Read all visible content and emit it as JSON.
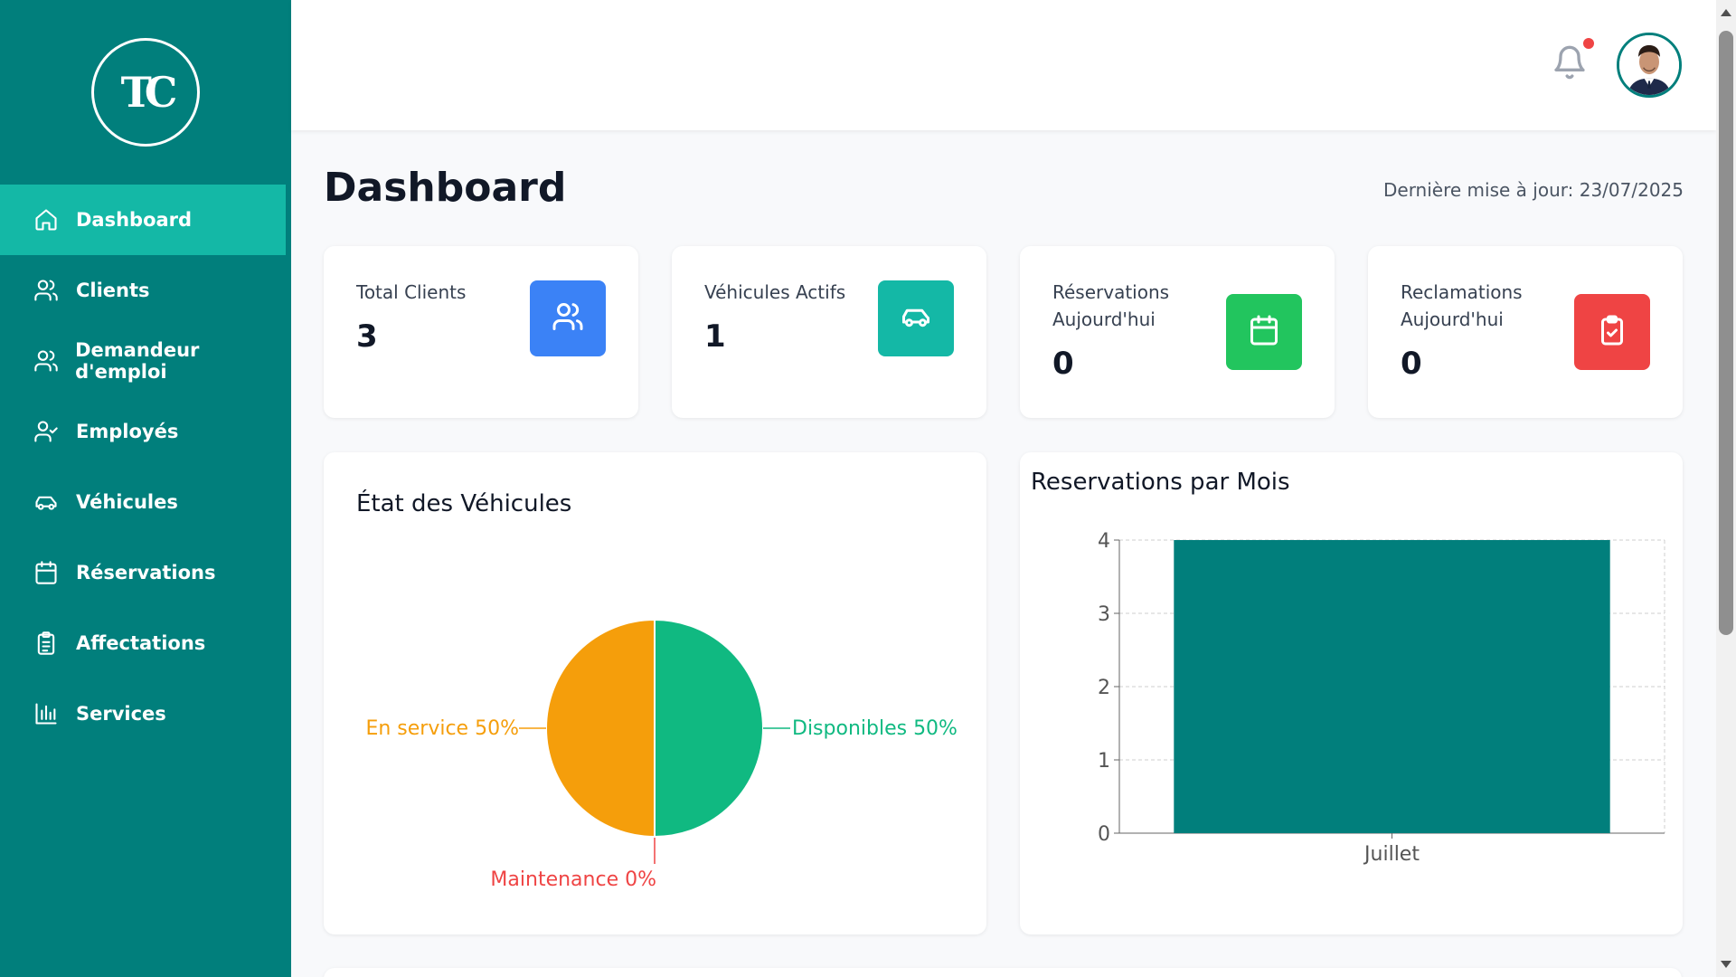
{
  "app": {
    "logo_text": "TC"
  },
  "sidebar": {
    "items": [
      {
        "label": "Dashboard",
        "icon": "home-icon",
        "active": true
      },
      {
        "label": "Clients",
        "icon": "users-icon",
        "active": false
      },
      {
        "label": "Demandeur d'emploi",
        "icon": "users-icon",
        "active": false
      },
      {
        "label": "Employés",
        "icon": "user-check-icon",
        "active": false
      },
      {
        "label": "Véhicules",
        "icon": "car-icon",
        "active": false
      },
      {
        "label": "Réservations",
        "icon": "calendar-icon",
        "active": false
      },
      {
        "label": "Affectations",
        "icon": "clipboard-list-icon",
        "active": false
      },
      {
        "label": "Services",
        "icon": "bar-chart-icon",
        "active": false
      }
    ]
  },
  "header": {
    "notification_icon": "bell-icon",
    "has_notification": true,
    "avatar": "user-avatar"
  },
  "main": {
    "title": "Dashboard",
    "last_update": "Dernière mise à jour: 23/07/2025",
    "stats": [
      {
        "label": "Total Clients",
        "value": "3",
        "icon": "users-icon",
        "color": "#3b82f6"
      },
      {
        "label": "Véhicules Actifs",
        "value": "1",
        "icon": "car-icon",
        "color": "#14b8a6"
      },
      {
        "label": "Réservations Aujourd'hui",
        "value": "0",
        "icon": "calendar-icon",
        "color": "#22c55e"
      },
      {
        "label": "Reclamations Aujourd'hui",
        "value": "0",
        "icon": "clipboard-check-icon",
        "color": "#ef4444"
      }
    ]
  },
  "chart_data": [
    {
      "type": "pie",
      "title": "État des Véhicules",
      "slices": [
        {
          "label": "Disponibles",
          "value": 50,
          "display": "Disponibles 50%",
          "color": "#10b981"
        },
        {
          "label": "Maintenance",
          "value": 0,
          "display": "Maintenance 0%",
          "color": "#ef4444"
        },
        {
          "label": "En service",
          "value": 50,
          "display": "En service 50%",
          "color": "#f59e0b"
        }
      ]
    },
    {
      "type": "bar",
      "title": "Reservations par Mois",
      "categories": [
        "Juillet"
      ],
      "values": [
        4
      ],
      "ylim": [
        0,
        4
      ],
      "yticks": [
        "0",
        "1",
        "2",
        "3",
        "4"
      ],
      "grid": true,
      "color": "#017f7c"
    }
  ]
}
